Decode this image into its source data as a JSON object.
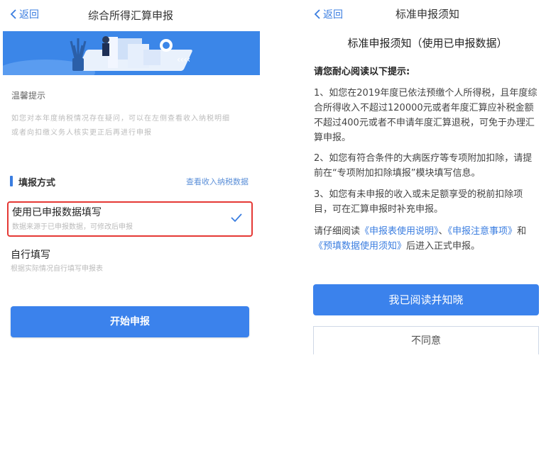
{
  "left": {
    "nav": {
      "back_label": "返回",
      "title": "综合所得汇算申报"
    },
    "hint": {
      "title": "温馨提示",
      "line1": "如您对本年度纳税情况存在疑问，可以在左侧查看收入纳税明细",
      "line2": "或者向扣缴义务人核实更正后再进行申报"
    },
    "method": {
      "label": "填报方式",
      "link": "查看收入纳税数据"
    },
    "options": [
      {
        "title": "使用已申报数据填写",
        "sub": "数据来源于已申报数据，可修改后申报",
        "selected": true
      },
      {
        "title": "自行填写",
        "sub": "根据实际情况自行填写申报表"
      }
    ],
    "start_button": "开始申报",
    "accent_color": "#3b82ec",
    "highlight_color": "#e53935"
  },
  "right": {
    "nav": {
      "back_label": "返回",
      "title": "标准申报须知"
    },
    "heading": "标准申报须知（使用已申报数据）",
    "subheading": "请您耐心阅读以下提示:",
    "para1": "1、如您在2019年度已依法预缴个人所得税，且年度综合所得收入不超过120000元或者年度汇算应补税金额不超过400元或者不申请年度汇算退税，可免于办理汇算申报。",
    "para2": "2、如您有符合条件的大病医疗等专项附加扣除，请提前在“专项附加扣除填报”模块填写信息。",
    "para3": "3、如您有未申报的收入或未足额享受的税前扣除项目，可在汇算申报时补充申报。",
    "para4": {
      "prefix": "请仔细阅读",
      "link1": "《申报表使用说明》",
      "sep1": "、",
      "link2": "《申报注意事项》",
      "sep2": "和",
      "link3": "《预填数据使用须知》",
      "suffix": "后进入正式申报。"
    },
    "agree_button": "我已阅读并知晓",
    "disagree_button": "不同意"
  }
}
